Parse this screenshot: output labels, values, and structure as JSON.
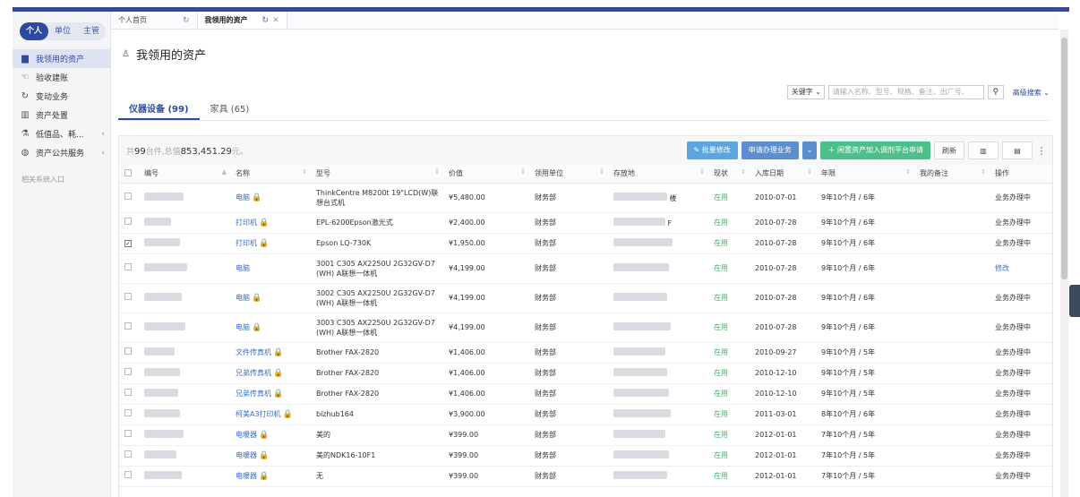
{
  "sidebar": {
    "role_tabs": [
      "个人",
      "单位",
      "主管"
    ],
    "items": [
      {
        "label": "我领用的资产",
        "icon": "asset-icon",
        "glyph": "▆"
      },
      {
        "label": "验收建账",
        "icon": "thumb-icon",
        "glyph": "☜"
      },
      {
        "label": "变动业务",
        "icon": "refresh-icon",
        "glyph": "↻"
      },
      {
        "label": "资产处置",
        "icon": "trash-icon",
        "glyph": "▥"
      },
      {
        "label": "低值品、耗...",
        "icon": "flask-icon",
        "glyph": "⚗"
      },
      {
        "label": "资产公共服务",
        "icon": "globe-icon",
        "glyph": "◍"
      }
    ],
    "related": "相关系统入口"
  },
  "tabs": [
    {
      "label": "个人首页"
    },
    {
      "label": "我领用的资产"
    }
  ],
  "page": {
    "title": "我领用的资产"
  },
  "search": {
    "keyword_select": "关键字",
    "placeholder": "请输入名称、型号、规格、备注、出厂号、",
    "advanced": "高级搜索"
  },
  "subtabs": [
    "仪器设备 (99)",
    "家具 (65)"
  ],
  "summary": {
    "prefix": "共",
    "count": "99",
    "middle": "台件,总值",
    "total": "853,451.29",
    "suffix": "元。"
  },
  "actions": {
    "batch_edit": "批量修改",
    "apply": "申请办理业务",
    "idle": "闲置资产加入调剂平台申请",
    "refresh": "刷新"
  },
  "columns": [
    "编号",
    "名称",
    "型号",
    "价值",
    "领用单位",
    "存放地",
    "现状",
    "入库日期",
    "年限",
    "我的备注",
    "操作"
  ],
  "rows": [
    {
      "name": "电脑",
      "lock": true,
      "model": "ThinkCentre M8200t 19\"LCD(W)联想台式机",
      "value": "¥5,480.00",
      "dept": "财务部",
      "loc_suffix": "楼",
      "status": "在用",
      "date": "2010-07-01",
      "years": "9年10个月 / 6年",
      "op": "业务办理中",
      "checked": false,
      "tall": true
    },
    {
      "name": "打印机",
      "lock": true,
      "model": "EPL-6200Epson激光式",
      "value": "¥2,400.00",
      "dept": "财务部",
      "loc_suffix": "F",
      "status": "在用",
      "date": "2010-07-28",
      "years": "9年10个月 / 6年",
      "op": "业务办理中",
      "checked": false,
      "tall": false
    },
    {
      "name": "打印机",
      "lock": true,
      "model": "Epson LQ-730K",
      "value": "¥1,950.00",
      "dept": "财务部",
      "loc_suffix": "",
      "status": "在用",
      "date": "2010-07-28",
      "years": "9年10个月 / 6年",
      "op": "业务办理中",
      "checked": true,
      "tall": false
    },
    {
      "name": "电脑",
      "lock": false,
      "model": "3001 C305 AX2250U 2G32GV-D7 (WH) A联想一体机",
      "value": "¥4,199.00",
      "dept": "财务部",
      "loc_suffix": "",
      "status": "在用",
      "date": "2010-07-28",
      "years": "9年10个月 / 6年",
      "op": "修改",
      "checked": false,
      "tall": true
    },
    {
      "name": "电脑",
      "lock": true,
      "model": "3002 C305 AX2250U 2G32GV-D7 (WH) A联想一体机",
      "value": "¥4,199.00",
      "dept": "财务部",
      "loc_suffix": "",
      "status": "在用",
      "date": "2010-07-28",
      "years": "9年10个月 / 6年",
      "op": "业务办理中",
      "checked": false,
      "tall": true
    },
    {
      "name": "电脑",
      "lock": true,
      "model": "3003 C305 AX2250U 2G32GV-D7 (WH) A联想一体机",
      "value": "¥4,199.00",
      "dept": "财务部",
      "loc_suffix": "",
      "status": "在用",
      "date": "2010-07-28",
      "years": "9年10个月 / 6年",
      "op": "业务办理中",
      "checked": false,
      "tall": true
    },
    {
      "name": "文件传真机",
      "lock": true,
      "model": "Brother FAX-2820",
      "value": "¥1,406.00",
      "dept": "财务部",
      "loc_suffix": "",
      "status": "在用",
      "date": "2010-09-27",
      "years": "9年10个月 / 5年",
      "op": "业务办理中",
      "checked": false,
      "tall": false
    },
    {
      "name": "兄弟传真机",
      "lock": true,
      "model": "Brother FAX-2820",
      "value": "¥1,406.00",
      "dept": "财务部",
      "loc_suffix": "",
      "status": "在用",
      "date": "2010-12-10",
      "years": "9年10个月 / 5年",
      "op": "业务办理中",
      "checked": false,
      "tall": false
    },
    {
      "name": "兄弟传真机",
      "lock": true,
      "model": "Brother FAX-2820",
      "value": "¥1,406.00",
      "dept": "财务部",
      "loc_suffix": "",
      "status": "在用",
      "date": "2010-12-10",
      "years": "9年10个月 / 5年",
      "op": "业务办理中",
      "checked": false,
      "tall": false
    },
    {
      "name": "柯美A3打印机",
      "lock": true,
      "model": "bizhub164",
      "value": "¥3,900.00",
      "dept": "财务部",
      "loc_suffix": "",
      "status": "在用",
      "date": "2011-03-01",
      "years": "8年10个月 / 6年",
      "op": "业务办理中",
      "checked": false,
      "tall": false
    },
    {
      "name": "电暖器",
      "lock": true,
      "model": "美的",
      "value": "¥399.00",
      "dept": "财务部",
      "loc_suffix": "",
      "status": "在用",
      "date": "2012-01-01",
      "years": "7年10个月 / 5年",
      "op": "业务办理中",
      "checked": false,
      "tall": false
    },
    {
      "name": "电暖器",
      "lock": true,
      "model": "美的NDK16-10F1",
      "value": "¥399.00",
      "dept": "财务部",
      "loc_suffix": "",
      "status": "在用",
      "date": "2012-01-01",
      "years": "7年10个月 / 5年",
      "op": "业务办理中",
      "checked": false,
      "tall": false
    },
    {
      "name": "电暖器",
      "lock": true,
      "model": "无",
      "value": "¥399.00",
      "dept": "财务部",
      "loc_suffix": "",
      "status": "在用",
      "date": "2012-01-01",
      "years": "7年10个月 / 5年",
      "op": "业务办理中",
      "checked": false,
      "tall": false
    }
  ]
}
